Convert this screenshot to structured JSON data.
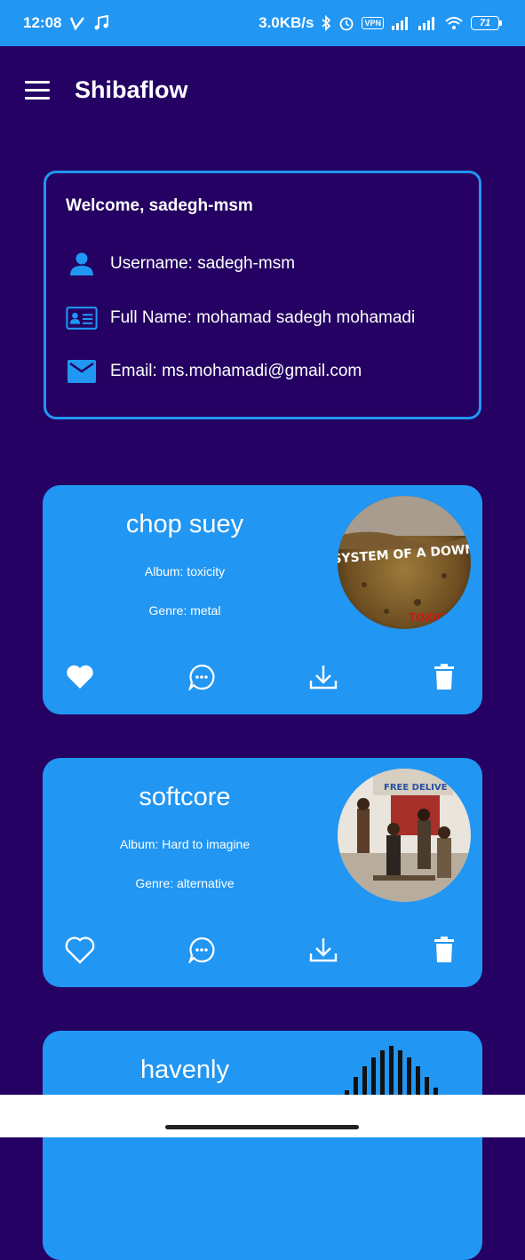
{
  "status_bar": {
    "time": "12:08",
    "net_speed": "3.0KB/s",
    "vpn": "VPN",
    "battery": "71"
  },
  "app_bar": {
    "title": "Shibaflow"
  },
  "profile": {
    "welcome": "Welcome, sadegh-msm",
    "username": "Username: sadegh-msm",
    "fullname": "Full Name: mohamad sadegh mohamadi",
    "email": "Email: ms.mohamadi@gmail.com"
  },
  "songs": [
    {
      "title": "chop suey",
      "album": "Album: toxicity",
      "genre": "Genre: metal",
      "art_text": "SYSTEM OF A DOWN",
      "art_subtext": "TOXICITY",
      "liked": true
    },
    {
      "title": "softcore",
      "album": "Album: Hard to imagine",
      "genre": "Genre: alternative",
      "art_text": "FREE DELIVE",
      "liked": false
    },
    {
      "title": "havenly"
    }
  ],
  "colors": {
    "background": "#240162",
    "accent": "#2196F3",
    "text": "#ffffff"
  },
  "icons": [
    "menu-icon",
    "person-icon",
    "id-card-icon",
    "mail-icon",
    "heart-icon",
    "comment-icon",
    "download-icon",
    "trash-icon"
  ]
}
